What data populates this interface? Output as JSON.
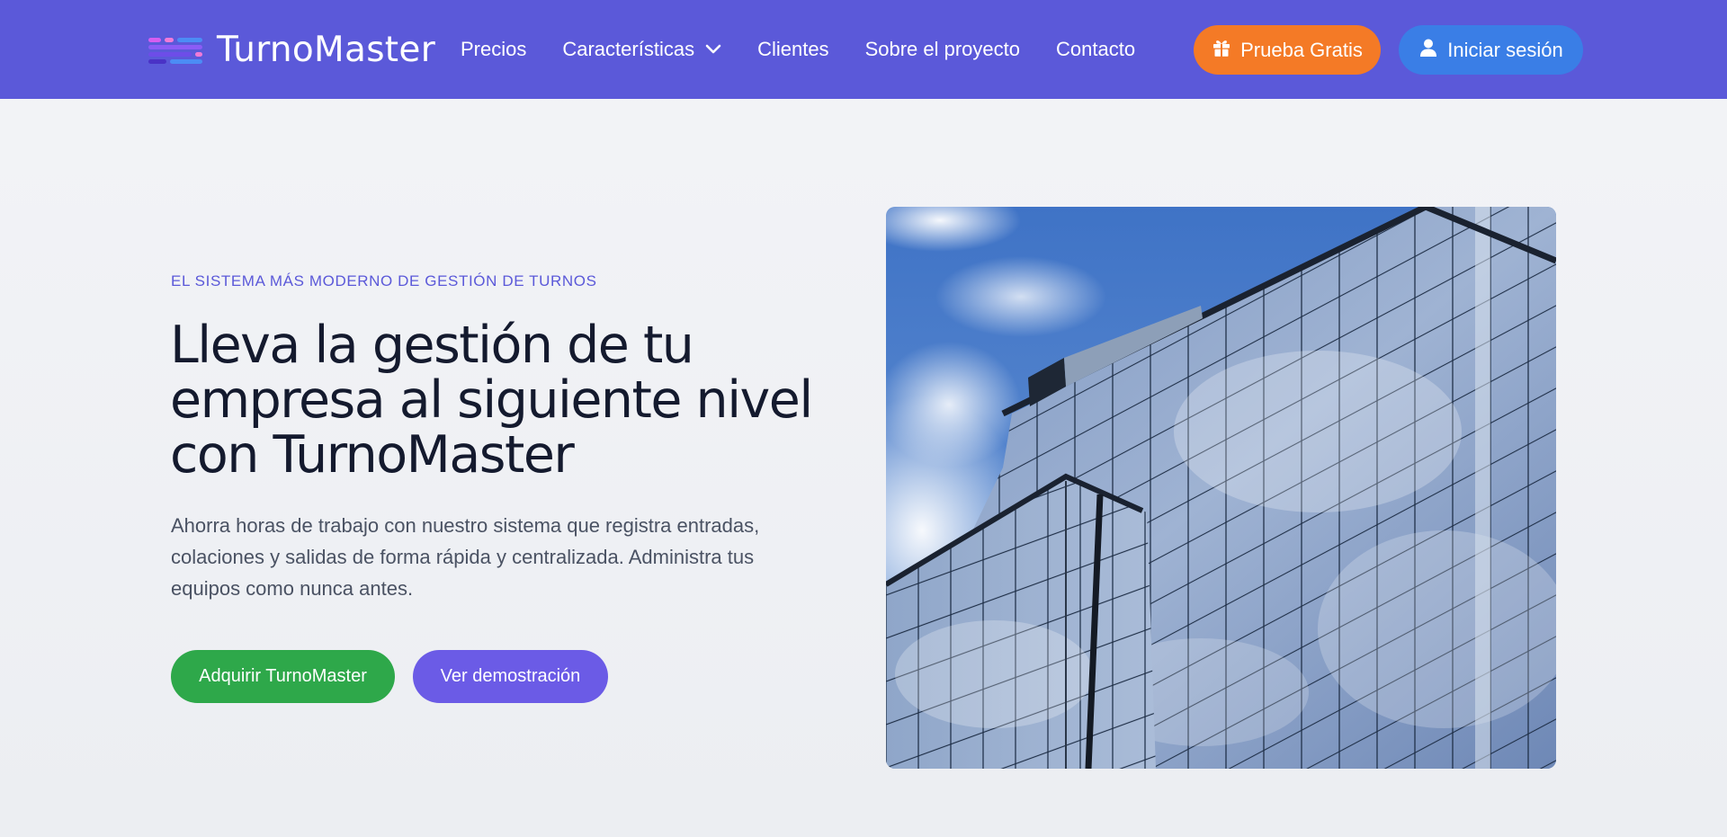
{
  "brand": {
    "name": "TurnoMaster",
    "logo_icon": "stacked-bars-logo"
  },
  "nav": {
    "items": [
      {
        "label": "Precios"
      },
      {
        "label": "Características",
        "icon": "chevron-down-icon"
      },
      {
        "label": "Clientes"
      },
      {
        "label": "Sobre el proyecto"
      },
      {
        "label": "Contacto"
      }
    ],
    "trial_button": {
      "label": "Prueba Gratis",
      "icon": "gift-icon",
      "color": "#f47a26"
    },
    "login_button": {
      "label": "Iniciar sesión",
      "icon": "user-icon",
      "color": "#3a7ee6"
    },
    "background": "#5b59d9"
  },
  "hero": {
    "eyebrow": "EL SISTEMA MÁS MODERNO DE GESTIÓN DE TURNOS",
    "headline": "Lleva la gestión de tu empresa al siguiente nivel con TurnoMaster",
    "lead": "Ahorra horas de trabajo con nuestro sistema que registra entradas, colaciones y salidas de forma rápida y centralizada. Administra tus equipos como nunca antes.",
    "primary_cta": {
      "label": "Adquirir TurnoMaster",
      "color": "#2ea84a"
    },
    "secondary_cta": {
      "label": "Ver demostración",
      "color": "#6b5be6"
    },
    "image": "glass-office-building"
  }
}
